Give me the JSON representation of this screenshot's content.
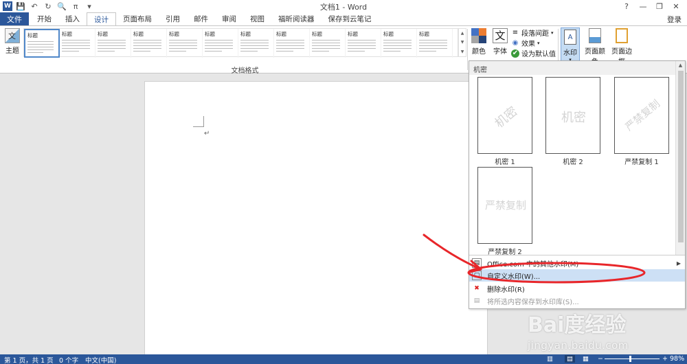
{
  "window": {
    "title": "文档1 - Word",
    "help": "?",
    "minimize": "—",
    "restore": "❐",
    "close": "✕"
  },
  "qat": {
    "app_icon": "W",
    "save": "💾",
    "undo": "↶",
    "redo": "↻",
    "preview": "🔍",
    "pi": "π",
    "customize": "▾"
  },
  "tabs": {
    "file": "文件",
    "items": [
      "开始",
      "插入",
      "设计",
      "页面布局",
      "引用",
      "邮件",
      "审阅",
      "视图",
      "福昕阅读器",
      "保存到云笔记"
    ],
    "active_index": 2,
    "login": "登录"
  },
  "ribbon": {
    "theme_label": "主题",
    "styles": [
      {
        "title": "标题"
      },
      {
        "title": "标题"
      },
      {
        "title": "标题"
      },
      {
        "title": "标题"
      },
      {
        "title": "标题"
      },
      {
        "title": "标题"
      },
      {
        "title": "标题"
      },
      {
        "title": "标题"
      },
      {
        "title": "标题"
      },
      {
        "title": "标题"
      },
      {
        "title": "标题"
      },
      {
        "title": "标题"
      }
    ],
    "group_label": "文档格式",
    "colors_label": "颜色",
    "fonts_label": "字体",
    "fonts_glyph": "文",
    "paragraph_spacing": "段落间距",
    "effects": "效果",
    "set_default": "设为默认值",
    "watermark": "水印",
    "page_color": "页面颜色",
    "page_border": "页面边框"
  },
  "watermark_menu": {
    "header": "机密",
    "items": [
      {
        "text": "机密",
        "caption": "机密 1"
      },
      {
        "text": "机密",
        "caption": "机密 2"
      },
      {
        "text": "严禁复制",
        "caption": "严禁复制 1"
      },
      {
        "text": "严禁复制",
        "caption": "严禁复制 2"
      }
    ],
    "actions": [
      {
        "label": "Office.com 中的其他水印(M)"
      },
      {
        "label": "自定义水印(W)..."
      },
      {
        "label": "删除水印(R)"
      },
      {
        "label": "将所选内容保存到水印库(S)..."
      }
    ]
  },
  "document": {
    "paragraph_mark": "↵"
  },
  "watermark_overlay": {
    "line1": "Bai度经验",
    "line2": "jingyan.baidu.com"
  },
  "status": {
    "page": "第 1 页，共 1 页",
    "words": "0 个字",
    "language": "中文(中国)",
    "zoom_minus": "−",
    "zoom_plus": "+",
    "zoom": "98%"
  },
  "colors": {
    "accent": "#2b579a",
    "annotation": "#e8262a",
    "highlight": "#cde0f5"
  }
}
